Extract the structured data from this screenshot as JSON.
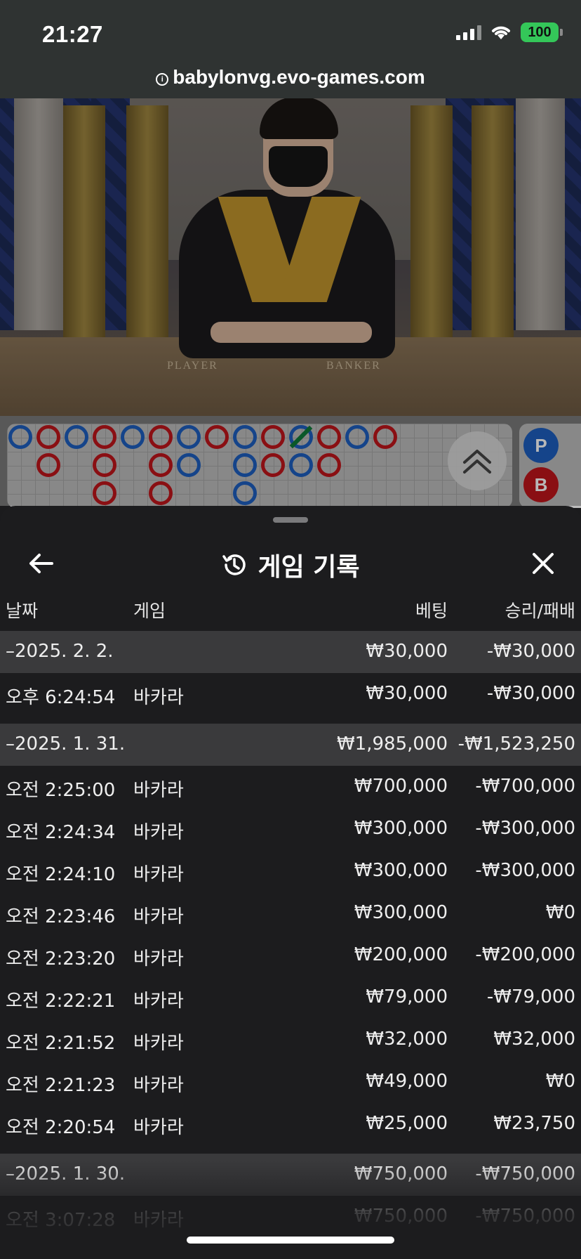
{
  "status_bar": {
    "time": "21:27",
    "battery": "100",
    "url": "babylonvg.evo-games.com"
  },
  "video": {
    "player_label": "PLAYER",
    "banker_label": "BANKER"
  },
  "roadmap": {
    "side_player": "P",
    "side_banker": "B"
  },
  "history": {
    "title": "게임 기록",
    "columns": {
      "date": "날짜",
      "game": "게임",
      "bet": "베팅",
      "win_loss": "승리/패배"
    },
    "rows": [
      {
        "type": "group",
        "date": "–2025. 2. 2.",
        "game": "",
        "bet": "₩30,000",
        "win_loss": "-₩30,000"
      },
      {
        "type": "item",
        "date": "오후 6:24:54",
        "game": "바카라",
        "bet": "₩30,000",
        "win_loss": "-₩30,000"
      },
      {
        "type": "group",
        "date": "–2025. 1. 31.",
        "game": "",
        "bet": "₩1,985,000",
        "win_loss": "-₩1,523,250"
      },
      {
        "type": "item",
        "date": "오전 2:25:00",
        "game": "바카라",
        "bet": "₩700,000",
        "win_loss": "-₩700,000"
      },
      {
        "type": "item",
        "date": "오전 2:24:34",
        "game": "바카라",
        "bet": "₩300,000",
        "win_loss": "-₩300,000"
      },
      {
        "type": "item",
        "date": "오전 2:24:10",
        "game": "바카라",
        "bet": "₩300,000",
        "win_loss": "-₩300,000"
      },
      {
        "type": "item",
        "date": "오전 2:23:46",
        "game": "바카라",
        "bet": "₩300,000",
        "win_loss": "₩0"
      },
      {
        "type": "item",
        "date": "오전 2:23:20",
        "game": "바카라",
        "bet": "₩200,000",
        "win_loss": "-₩200,000"
      },
      {
        "type": "item",
        "date": "오전 2:22:21",
        "game": "바카라",
        "bet": "₩79,000",
        "win_loss": "-₩79,000"
      },
      {
        "type": "item",
        "date": "오전 2:21:52",
        "game": "바카라",
        "bet": "₩32,000",
        "win_loss": "₩32,000"
      },
      {
        "type": "item",
        "date": "오전 2:21:23",
        "game": "바카라",
        "bet": "₩49,000",
        "win_loss": "₩0"
      },
      {
        "type": "item",
        "date": "오전 2:20:54",
        "game": "바카라",
        "bet": "₩25,000",
        "win_loss": "₩23,750"
      },
      {
        "type": "group",
        "date": "–2025. 1. 30.",
        "game": "",
        "bet": "₩750,000",
        "win_loss": "-₩750,000"
      },
      {
        "type": "item",
        "date": "오전 3:07:28",
        "game": "바카라",
        "bet": "₩750,000",
        "win_loss": "-₩750,000"
      }
    ]
  },
  "colors": {
    "player_blue": "#1e5fbf",
    "banker_red": "#c0151b",
    "tie_green": "#0f7a3a",
    "battery_green": "#34c759"
  }
}
